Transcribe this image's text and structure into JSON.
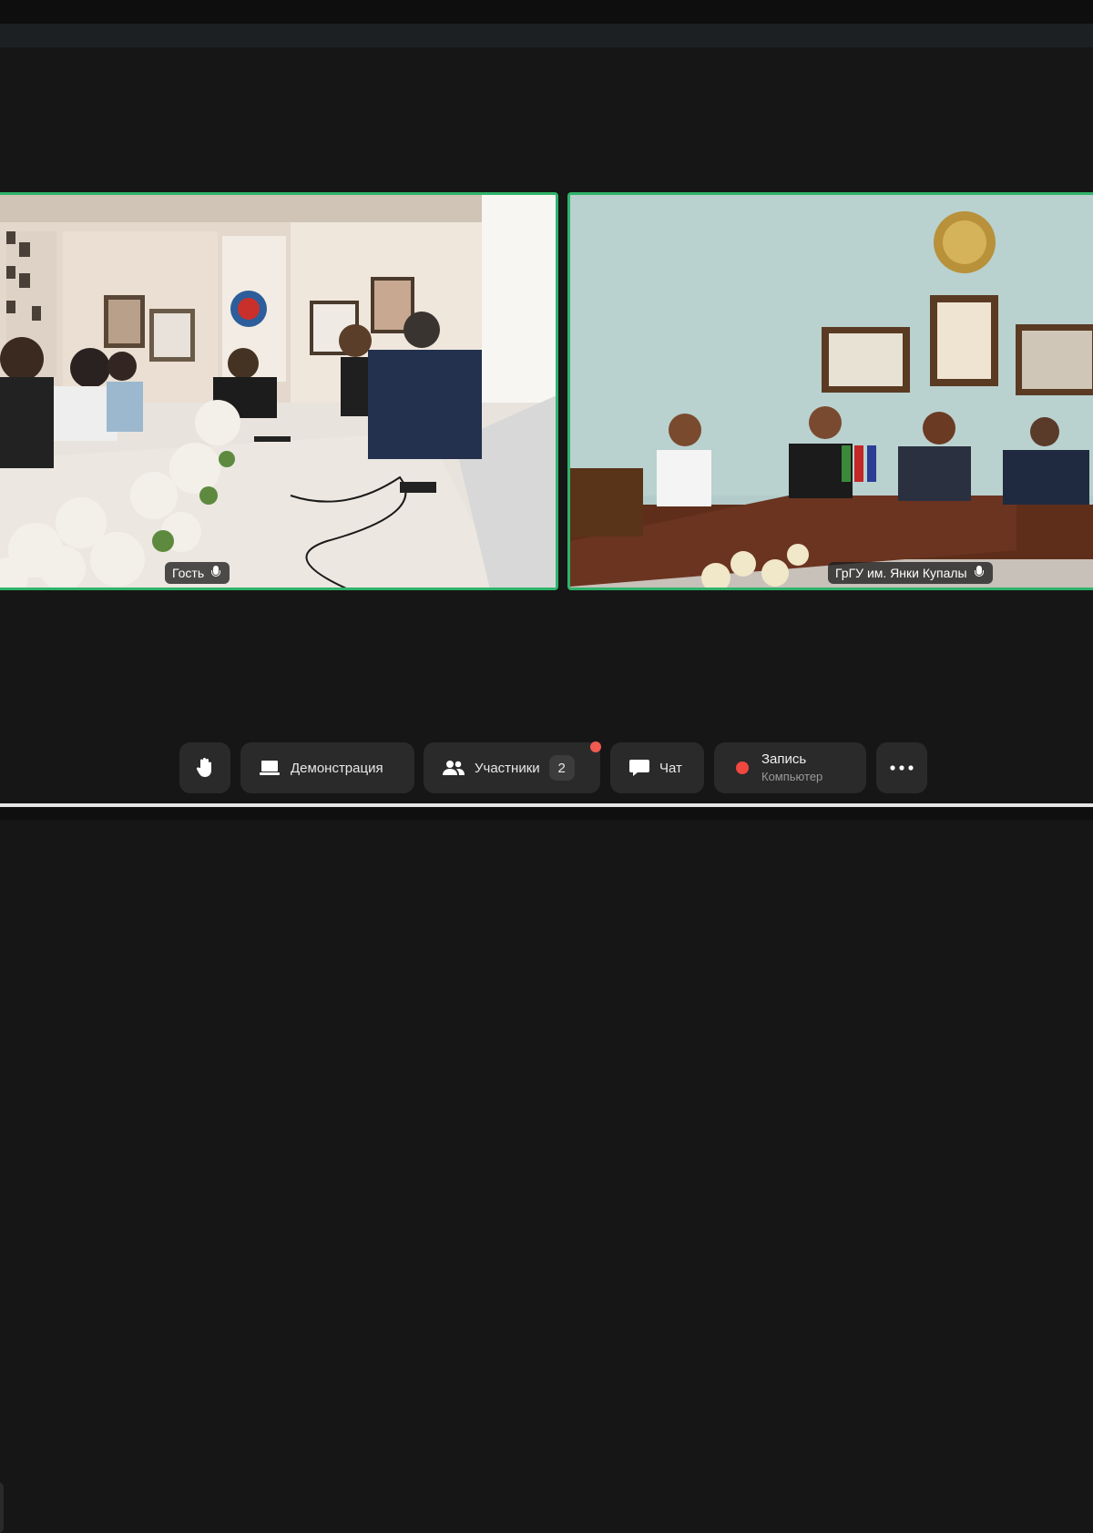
{
  "participants": [
    {
      "name": "Гость",
      "mic": "mic-icon"
    },
    {
      "name": "ГрГУ им. Янки Купалы",
      "mic": "mic-icon"
    }
  ],
  "toolbar": {
    "raise_hand_icon": "hand-icon",
    "demo_label": "Демонстрация",
    "participants_label": "Участники",
    "participants_count": "2",
    "chat_label": "Чат",
    "record_label": "Запись",
    "record_sub": "Компьютер",
    "more_icon": "more-icon"
  },
  "colors": {
    "active_border": "#2fb36a",
    "notify_dot": "#f05a4f",
    "record_dot": "#f0473e",
    "toolbar_button": "#2a2a2b",
    "background": "#161616"
  }
}
